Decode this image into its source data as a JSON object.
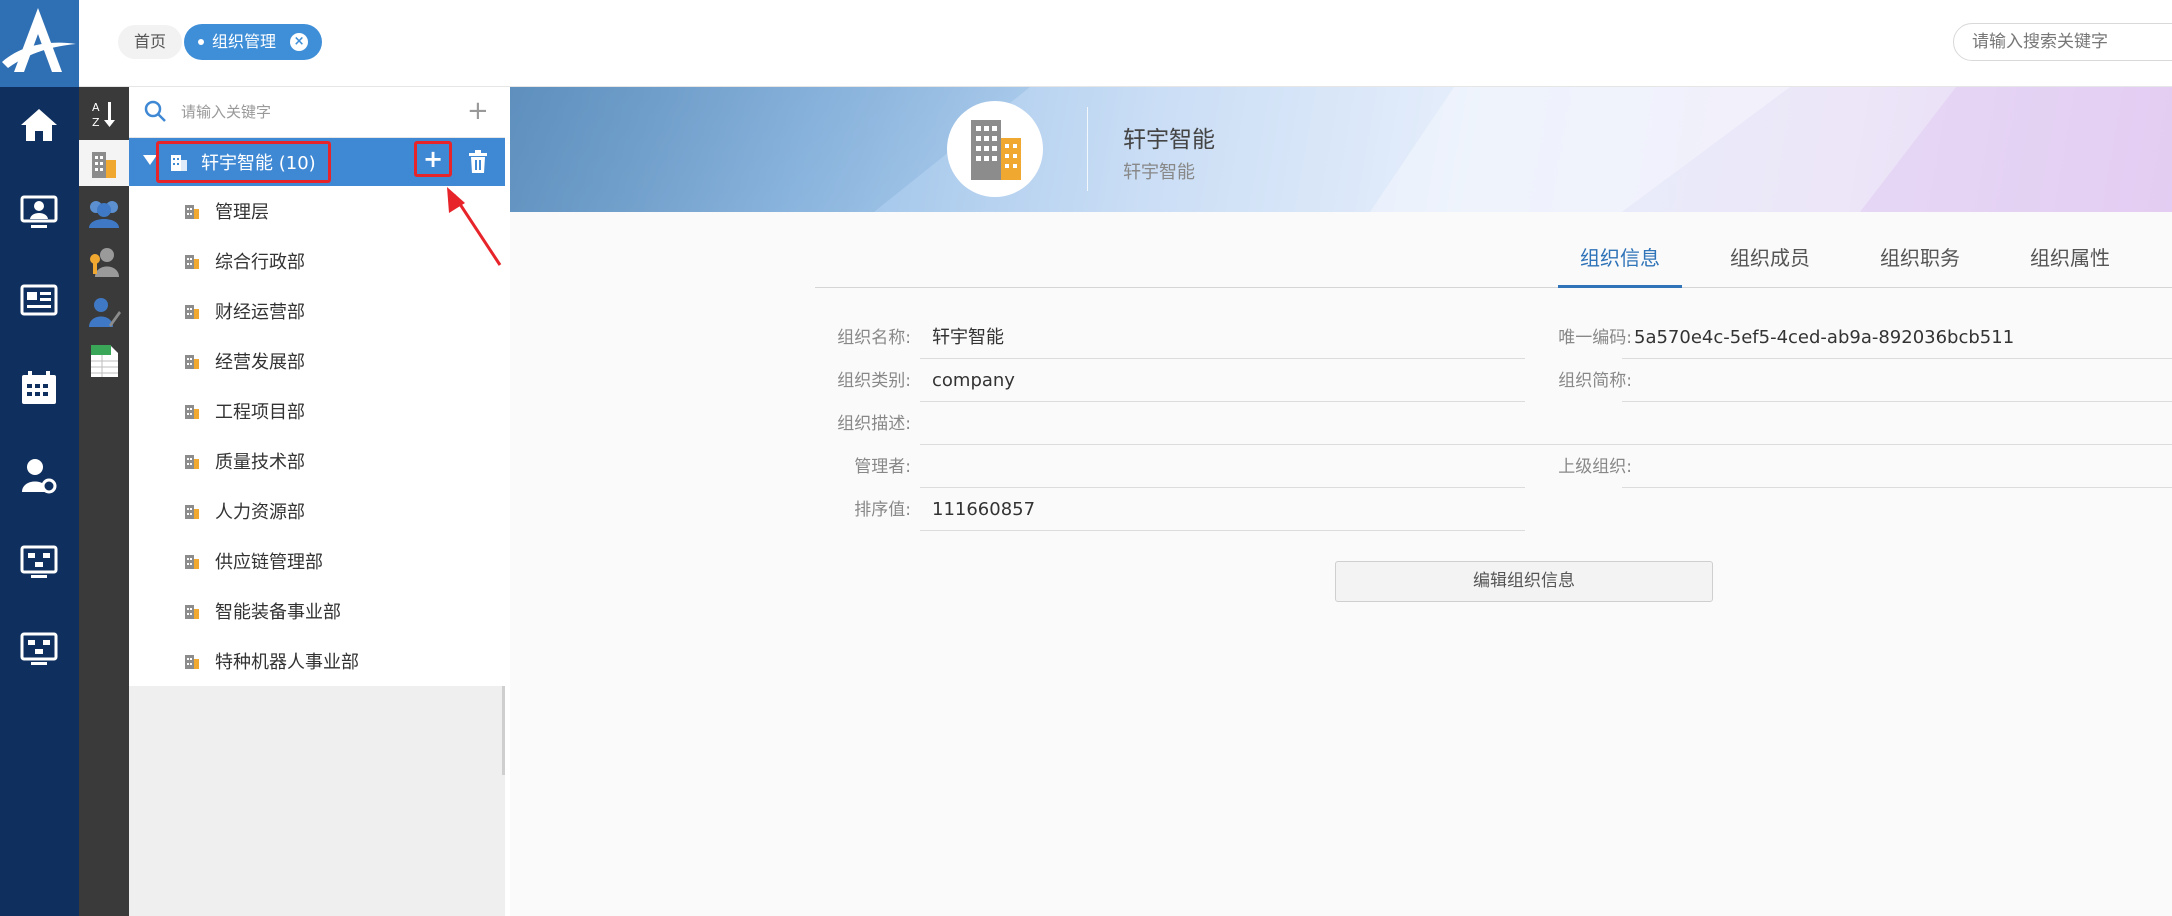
{
  "topbar": {
    "tabs": [
      {
        "label": "首页"
      },
      {
        "label": "组织管理",
        "close": "×"
      }
    ],
    "search_placeholder": "请输入搜索关键字"
  },
  "mainnav": {
    "icons": [
      "home-icon",
      "monitor-user-icon",
      "newspaper-icon",
      "calendar-icon",
      "user-settings-icon",
      "flowchart-monitor-icon",
      "flowchart-monitor-icon"
    ]
  },
  "subnav": {
    "icons": [
      "sort-az-icon",
      "buildings-icon",
      "users-group-icon",
      "user-key-icon",
      "user-edit-icon",
      "spreadsheet-icon"
    ]
  },
  "tree": {
    "search_placeholder": "请输入关键字",
    "add_symbol": "+",
    "root": {
      "label": "轩宇智能 (10)"
    },
    "children": [
      "管理层",
      "综合行政部",
      "财经运营部",
      "经营发展部",
      "工程项目部",
      "质量技术部",
      "人力资源部",
      "供应链管理部",
      "智能装备事业部",
      "特种机器人事业部"
    ]
  },
  "banner": {
    "title": "轩宇智能",
    "subtitle": "轩宇智能"
  },
  "content_tabs": [
    {
      "label": "组织信息",
      "active": true
    },
    {
      "label": "组织成员"
    },
    {
      "label": "组织职务"
    },
    {
      "label": "组织属性"
    }
  ],
  "form": {
    "name_label": "组织名称:",
    "name_value": "轩宇智能",
    "code_label": "唯一编码:",
    "code_value": "5a570e4c-5ef5-4ced-ab9a-892036bcb511",
    "type_label": "组织类别:",
    "type_value": "company",
    "short_label": "组织简称:",
    "short_value": "",
    "desc_label": "组织描述:",
    "desc_value": "",
    "manager_label": "管理者:",
    "manager_value": "",
    "parent_label": "上级组织:",
    "parent_value": "",
    "sort_label": "排序值:",
    "sort_value": "111660857"
  },
  "edit_button": "编辑组织信息",
  "colors": {
    "nav_dark": "#0f2f5e",
    "accent": "#3f88d4",
    "highlight_red": "#e8242b"
  }
}
